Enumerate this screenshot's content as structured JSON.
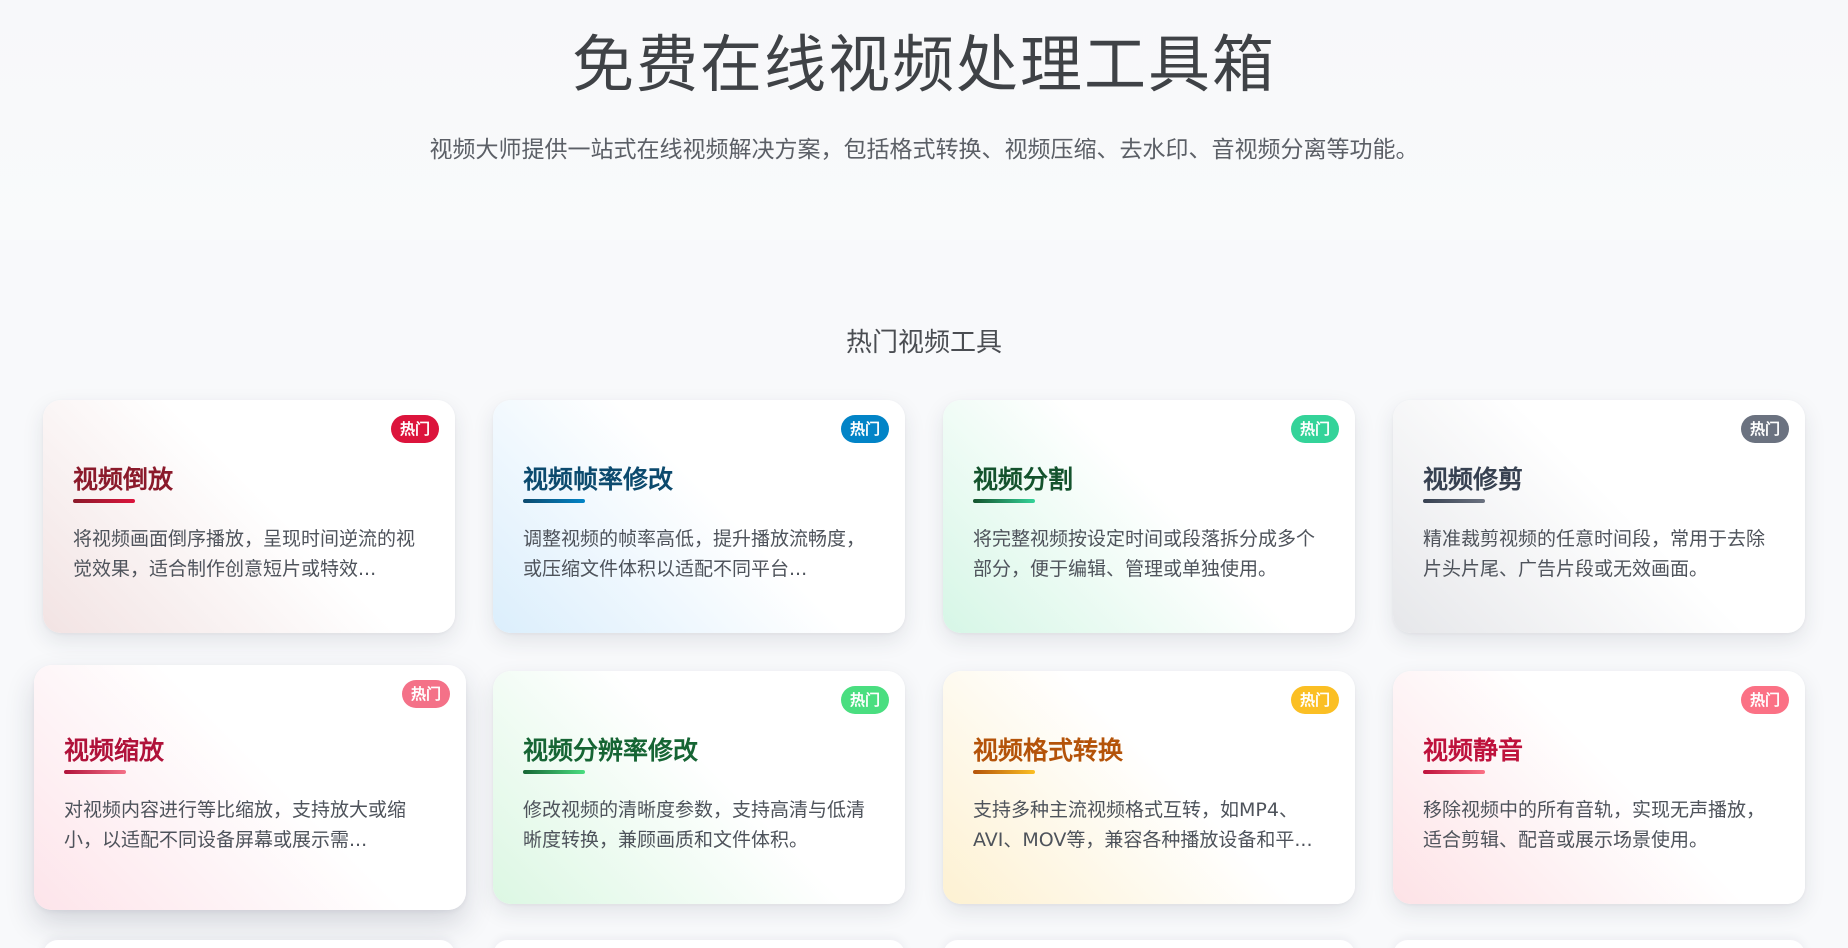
{
  "hero": {
    "title": "免费在线视频处理工具箱",
    "subtitle": "视频大师提供一站式在线视频解决方案，包括格式转换、视频压缩、去水印、音视频分离等功能。"
  },
  "section": {
    "title": "热门视频工具"
  },
  "cards": [
    {
      "title": "视频倒放",
      "badge": "热门",
      "description": "将视频画面倒序播放，呈现时间逆流的视觉效果，适合制作创意短片或特效...",
      "color": "#8b1a2b",
      "badge_color": "#dc143c",
      "tint": "#f2e3e3"
    },
    {
      "title": "视频帧率修改",
      "badge": "热门",
      "description": "调整视频的帧率高低，提升播放流畅度，或压缩文件体积以适配不同平台...",
      "color": "#0c4a6e",
      "badge_color": "#0284c7",
      "tint": "#dbeefc"
    },
    {
      "title": "视频分割",
      "badge": "热门",
      "description": "将完整视频按设定时间或段落拆分成多个部分，便于编辑、管理或单独使用。",
      "color": "#14532d",
      "badge_color": "#34d399",
      "tint": "#d6f6e6"
    },
    {
      "title": "视频修剪",
      "badge": "热门",
      "description": "精准裁剪视频的任意时间段，常用于去除片头片尾、广告片段或无效画面。",
      "color": "#374151",
      "badge_color": "#6b7280",
      "tint": "#e6e7ea"
    },
    {
      "title": "视频缩放",
      "badge": "热门",
      "description": "对视频内容进行等比缩放，支持放大或缩小，以适配不同设备屏幕或展示需...",
      "color": "#b0123a",
      "badge_color": "#f47188",
      "tint": "#fde4ea"
    },
    {
      "title": "视频分辨率修改",
      "badge": "热门",
      "description": "修改视频的清晰度参数，支持高清与低清晰度转换，兼顾画质和文件体积。",
      "color": "#166534",
      "badge_color": "#4ade80",
      "tint": "#dcf7e3"
    },
    {
      "title": "视频格式转换",
      "badge": "热门",
      "description": "支持多种主流视频格式互转，如MP4、AVI、MOV等，兼容各种播放设备和平...",
      "color": "#b45309",
      "badge_color": "#fbbf24",
      "tint": "#fdf1d2"
    },
    {
      "title": "视频静音",
      "badge": "热门",
      "description": "移除视频中的所有音轨，实现无声播放，适合剪辑、配音或展示场景使用。",
      "color": "#be123c",
      "badge_color": "#fb7185",
      "tint": "#fde2e6"
    }
  ]
}
